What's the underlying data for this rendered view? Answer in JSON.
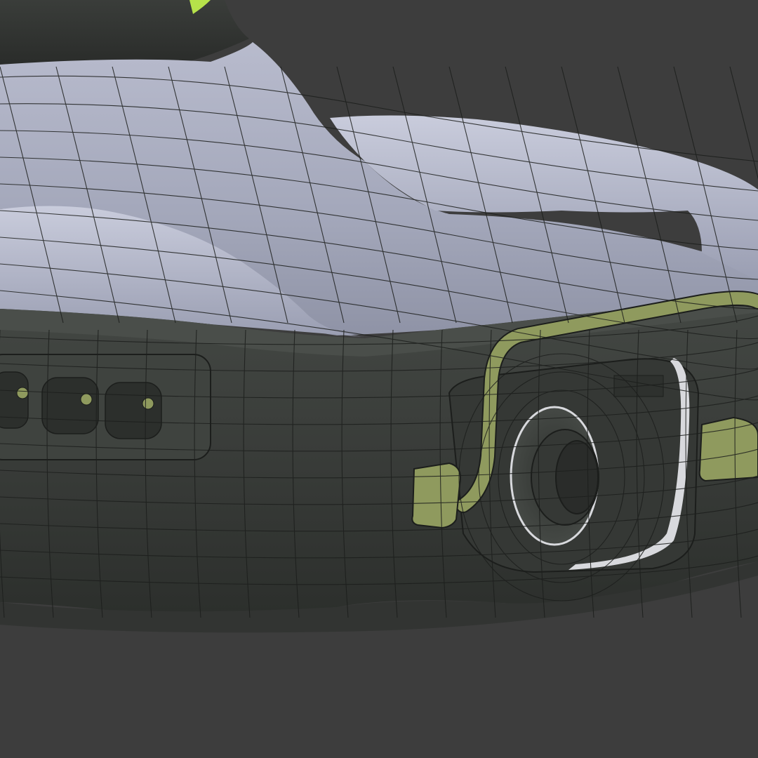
{
  "scene": {
    "background": "#3d3d3d",
    "body_top_color": "#a7abbe",
    "body_top_light": "#c4c7d8",
    "body_dark_color": "#3a3e3a",
    "body_dark_shade": "#2b2e2b",
    "tow_bar_color": "#8f9a5e",
    "accent_green": "#b6e24a",
    "wire_color": "#1c1e1c"
  }
}
